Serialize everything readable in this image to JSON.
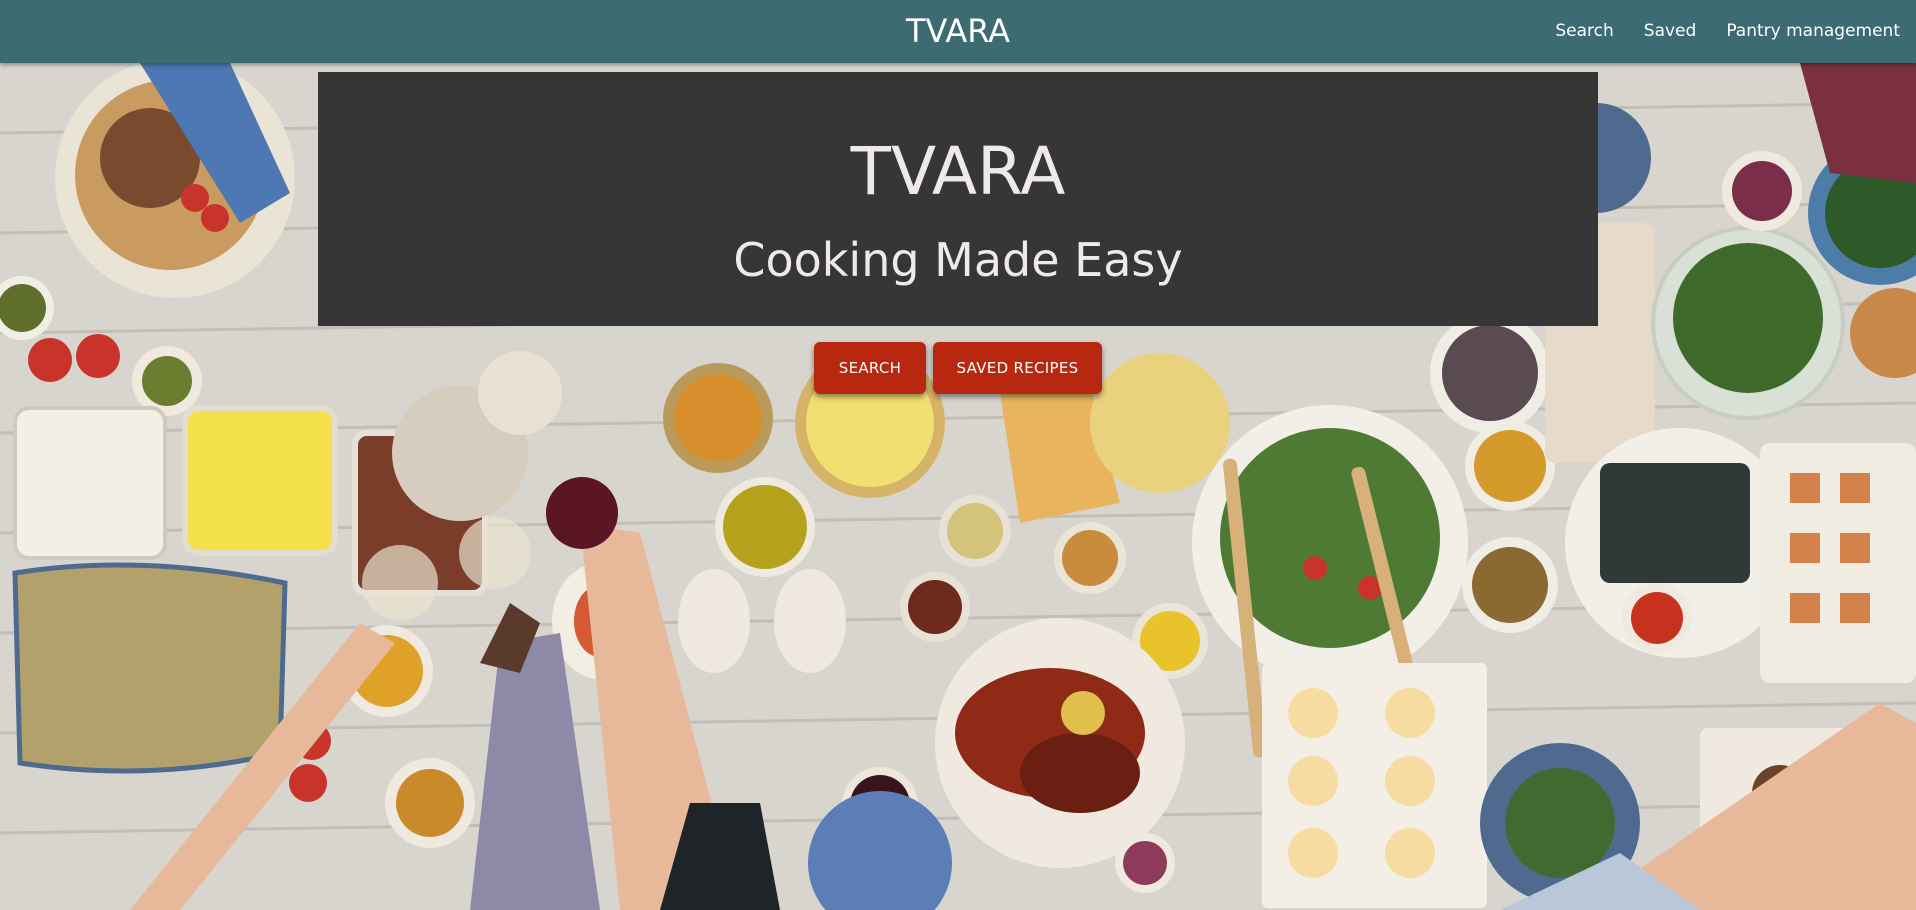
{
  "navbar": {
    "brand": "TVARA",
    "links": [
      {
        "label": "Search"
      },
      {
        "label": "Saved"
      },
      {
        "label": "Pantry management"
      }
    ]
  },
  "hero": {
    "title": "TVARA",
    "subtitle": "Cooking Made Easy",
    "buttons": {
      "search_label": "SEARCH",
      "saved_label": "SAVED RECIPES"
    }
  },
  "colors": {
    "navbar": "#3c6b71",
    "banner": "#363636",
    "button": "#b8270f",
    "banner_text": "#efe9ea"
  }
}
